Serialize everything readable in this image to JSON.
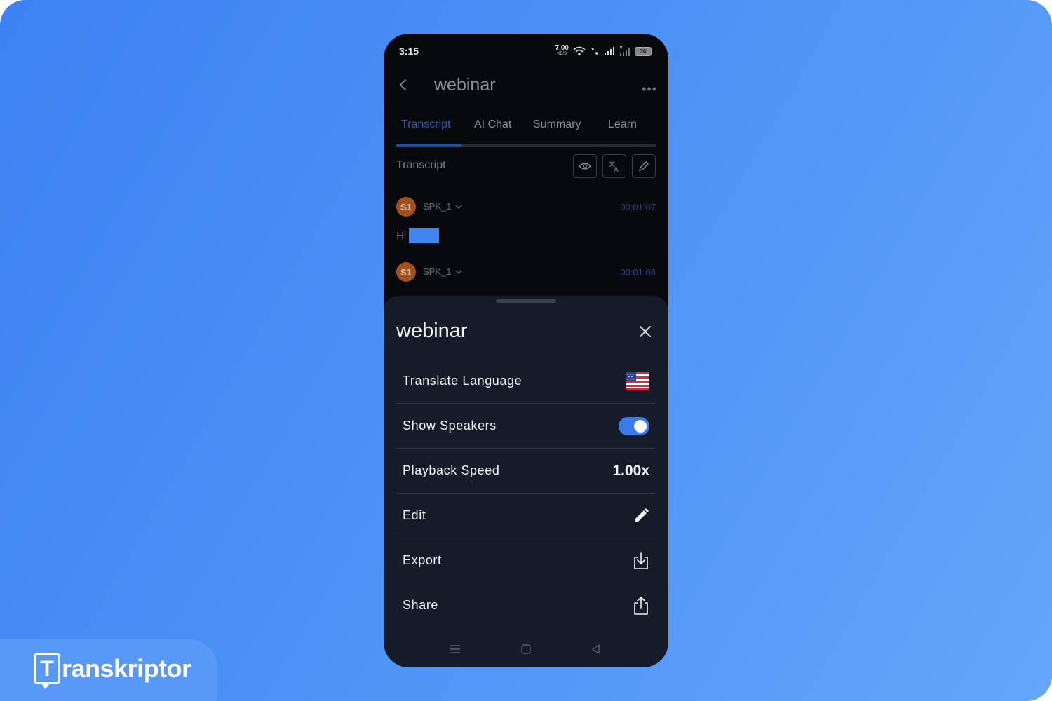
{
  "brand": {
    "name_initial": "T",
    "name_rest": "ranskriptor"
  },
  "status_bar": {
    "time": "3:15",
    "net_speed": "7.00",
    "net_unit": "KB/S",
    "battery": "36"
  },
  "app_bar": {
    "title": "webinar",
    "more_label": "•••"
  },
  "tabs": [
    {
      "label": "Transcript",
      "active": true
    },
    {
      "label": "AI Chat",
      "active": false
    },
    {
      "label": "Summary",
      "active": false
    },
    {
      "label": "Learn",
      "active": false
    }
  ],
  "transcript_header": {
    "label": "Transcript",
    "tools": [
      "eye-icon",
      "translate-icon",
      "pencil-icon"
    ]
  },
  "segments": [
    {
      "avatar": "S1",
      "speaker": "SPK_1",
      "timestamp": "00:01:07",
      "text": "Hi"
    },
    {
      "avatar": "S1",
      "speaker": "SPK_1",
      "timestamp": "00:01:08",
      "text": ""
    }
  ],
  "sheet": {
    "title": "webinar",
    "rows": [
      {
        "label": "Translate Language",
        "control": "us-flag-icon"
      },
      {
        "label": "Show Speakers",
        "control": "toggle",
        "toggle_on": true
      },
      {
        "label": "Playback Speed",
        "value": "1.00x"
      },
      {
        "label": "Edit",
        "control": "pencil-icon"
      },
      {
        "label": "Export",
        "control": "download-icon"
      },
      {
        "label": "Share",
        "control": "share-icon"
      }
    ]
  },
  "colors": {
    "background": "#4a8ff5",
    "phone": "#08090d",
    "sheet": "#161b29",
    "accent": "#3b7bf0",
    "avatar": "#a0521e",
    "highlight": "#3f86f2"
  }
}
